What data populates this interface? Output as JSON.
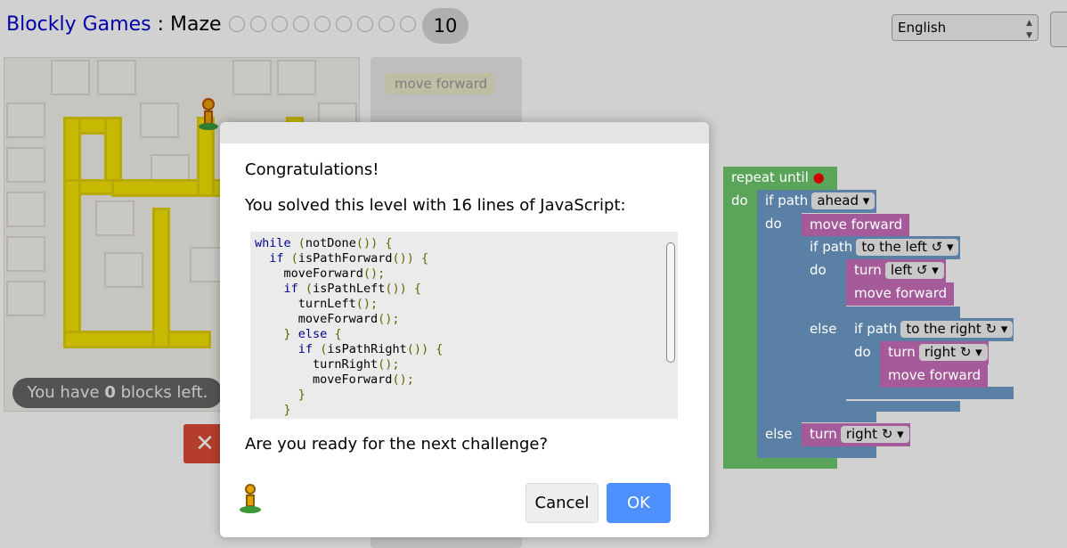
{
  "header": {
    "brand": "Blockly Games",
    "separator": " : ",
    "game": "Maze",
    "level": "10",
    "language": "English"
  },
  "status": {
    "blocks_left_prefix": "You have ",
    "blocks_left_count": "0",
    "blocks_left_suffix": " blocks left."
  },
  "toolbox": {
    "item": "move forward"
  },
  "workspace": {
    "repeat_until": "repeat until",
    "do": "do",
    "else": "else",
    "if_path": "if path",
    "ahead": "ahead ▾",
    "to_the_left": "to the left ↺ ▾",
    "to_the_right": "to the right ↻ ▾",
    "turn": "turn",
    "left": "left ↺ ▾",
    "right": "right ↻ ▾",
    "move_forward": "move forward"
  },
  "dialog": {
    "title": "Congratulations!",
    "message": "You solved this level with 16 lines of JavaScript:",
    "question": "Are you ready for the next challenge?",
    "cancel_label": "Cancel",
    "ok_label": "OK",
    "code_lines": [
      "while (notDone()) {",
      "  if (isPathForward()) {",
      "    moveForward();",
      "    if (isPathLeft()) {",
      "      turnLeft();",
      "      moveForward();",
      "    } else {",
      "      if (isPathRight()) {",
      "        turnRight();",
      "        moveForward();",
      "      }",
      "    }"
    ]
  },
  "colors": {
    "link": "#0000cc",
    "ok_button": "#4d90fe",
    "reset_button": "#dd4b39",
    "loop_block": "#5ba55b",
    "logic_block": "#5b80a5",
    "action_block": "#a55b99",
    "path": "#f2e200"
  }
}
